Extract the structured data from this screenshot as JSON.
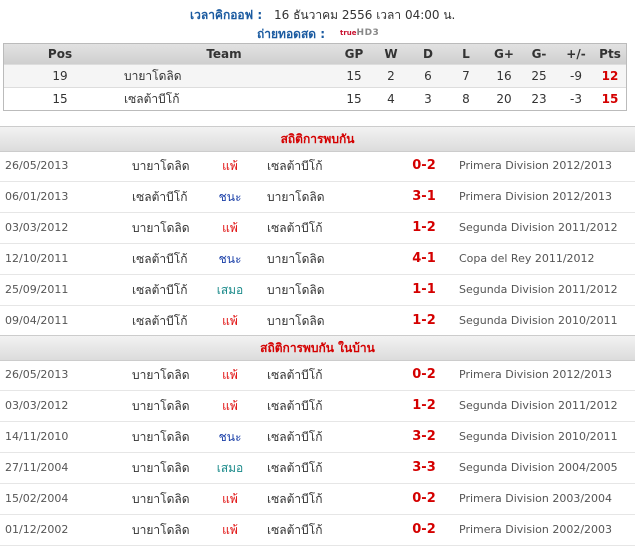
{
  "kickoff": {
    "label": "เวลาคิกออฟ :",
    "value": "16 ธันวาคม 2556 เวลา 04:00 น."
  },
  "broadcast": {
    "label": "ถ่ายทอดสด :",
    "channel_top": "true",
    "channel_main": "HD3"
  },
  "colors": {
    "win": "#1a3fa8",
    "loss": "#e01010",
    "draw": "#1a8a8a",
    "score": "#d40000",
    "title_blue": "#1a5aa0"
  },
  "standings": {
    "headers": {
      "pos": "Pos",
      "team": "Team",
      "gp": "GP",
      "w": "W",
      "d": "D",
      "l": "L",
      "gf": "G+",
      "ga": "G-",
      "pm": "+/-",
      "pts": "Pts"
    },
    "rows": [
      {
        "pos": "19",
        "team": "บายาโดลิด",
        "gp": "15",
        "w": "2",
        "d": "6",
        "l": "7",
        "gf": "16",
        "ga": "25",
        "pm": "-9",
        "pts": "12"
      },
      {
        "pos": "15",
        "team": "เซลต้าบีโก้",
        "gp": "15",
        "w": "4",
        "d": "3",
        "l": "8",
        "gf": "20",
        "ga": "23",
        "pm": "-3",
        "pts": "15"
      }
    ]
  },
  "h2h": {
    "title": "สถิติการพบกัน",
    "rows": [
      {
        "date": "26/05/2013",
        "home": "บายาโดลิด",
        "result": "แพ้",
        "result_type": "loss",
        "away": "เซลต้าบีโก้",
        "score": "0-2",
        "comp": "Primera Division 2012/2013"
      },
      {
        "date": "06/01/2013",
        "home": "เซลต้าบีโก้",
        "result": "ชนะ",
        "result_type": "win",
        "away": "บายาโดลิด",
        "score": "3-1",
        "comp": "Primera Division 2012/2013"
      },
      {
        "date": "03/03/2012",
        "home": "บายาโดลิด",
        "result": "แพ้",
        "result_type": "loss",
        "away": "เซลต้าบีโก้",
        "score": "1-2",
        "comp": "Segunda Division 2011/2012"
      },
      {
        "date": "12/10/2011",
        "home": "เซลต้าบีโก้",
        "result": "ชนะ",
        "result_type": "win",
        "away": "บายาโดลิด",
        "score": "4-1",
        "comp": "Copa del Rey 2011/2012"
      },
      {
        "date": "25/09/2011",
        "home": "เซลต้าบีโก้",
        "result": "เสมอ",
        "result_type": "draw",
        "away": "บายาโดลิด",
        "score": "1-1",
        "comp": "Segunda Division 2011/2012"
      },
      {
        "date": "09/04/2011",
        "home": "เซลต้าบีโก้",
        "result": "แพ้",
        "result_type": "loss",
        "away": "บายาโดลิด",
        "score": "1-2",
        "comp": "Segunda Division 2010/2011"
      }
    ]
  },
  "home_h2h": {
    "title": "สถิติการพบกัน ในบ้าน",
    "rows": [
      {
        "date": "26/05/2013",
        "home": "บายาโดลิด",
        "result": "แพ้",
        "result_type": "loss",
        "away": "เซลต้าบีโก้",
        "score": "0-2",
        "comp": "Primera Division 2012/2013"
      },
      {
        "date": "03/03/2012",
        "home": "บายาโดลิด",
        "result": "แพ้",
        "result_type": "loss",
        "away": "เซลต้าบีโก้",
        "score": "1-2",
        "comp": "Segunda Division 2011/2012"
      },
      {
        "date": "14/11/2010",
        "home": "บายาโดลิด",
        "result": "ชนะ",
        "result_type": "win",
        "away": "เซลต้าบีโก้",
        "score": "3-2",
        "comp": "Segunda Division 2010/2011"
      },
      {
        "date": "27/11/2004",
        "home": "บายาโดลิด",
        "result": "เสมอ",
        "result_type": "draw",
        "away": "เซลต้าบีโก้",
        "score": "3-3",
        "comp": "Segunda Division 2004/2005"
      },
      {
        "date": "15/02/2004",
        "home": "บายาโดลิด",
        "result": "แพ้",
        "result_type": "loss",
        "away": "เซลต้าบีโก้",
        "score": "0-2",
        "comp": "Primera Division 2003/2004"
      },
      {
        "date": "01/12/2002",
        "home": "บายาโดลิด",
        "result": "แพ้",
        "result_type": "loss",
        "away": "เซลต้าบีโก้",
        "score": "0-2",
        "comp": "Primera Division 2002/2003"
      }
    ]
  }
}
